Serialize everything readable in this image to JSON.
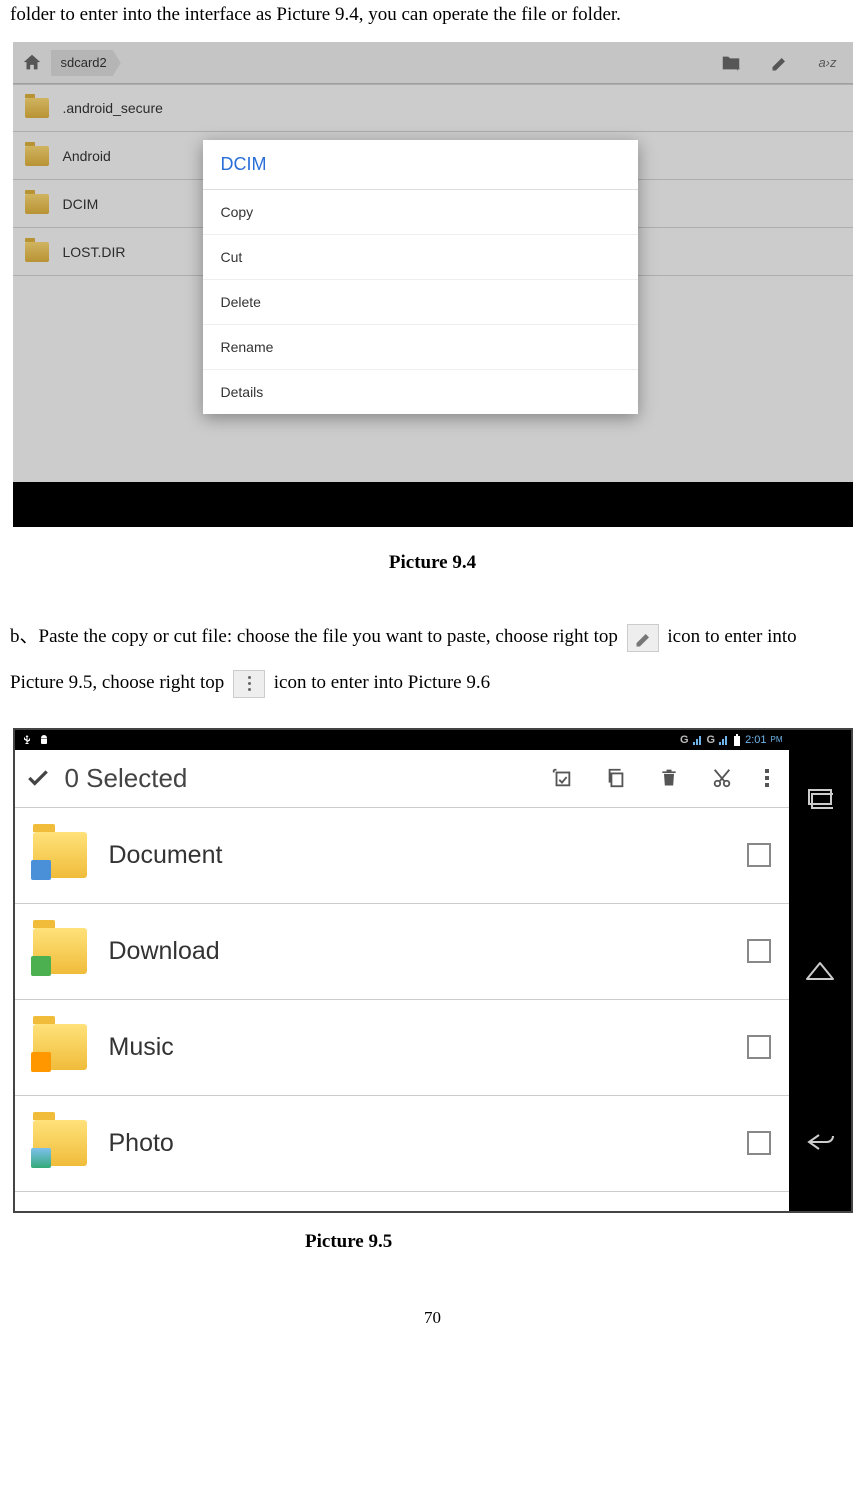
{
  "intro_line": "folder to enter into the interface as Picture 9.4, you can operate the file or folder.",
  "fig94": {
    "breadcrumb": "sdcard2",
    "folders": [
      ".android_secure",
      "Android",
      "DCIM",
      "LOST.DIR"
    ],
    "popup_title": "DCIM",
    "popup_items": [
      "Copy",
      "Cut",
      "Delete",
      "Rename",
      "Details"
    ]
  },
  "caption94": "Picture 9.4",
  "para_b_1": "b、Paste the copy or cut file: choose the file you want to paste, choose right top ",
  "para_b_2": " icon to enter into Picture 9.5, choose right top ",
  "para_b_3": " icon to enter into Picture 9.6",
  "fig95": {
    "status_time": "2:01",
    "status_ampm": "PM",
    "selected_text": "0 Selected",
    "rows": [
      "Document",
      "Download",
      "Music",
      "Photo"
    ]
  },
  "caption95": "Picture 9.5",
  "page_number": "70"
}
